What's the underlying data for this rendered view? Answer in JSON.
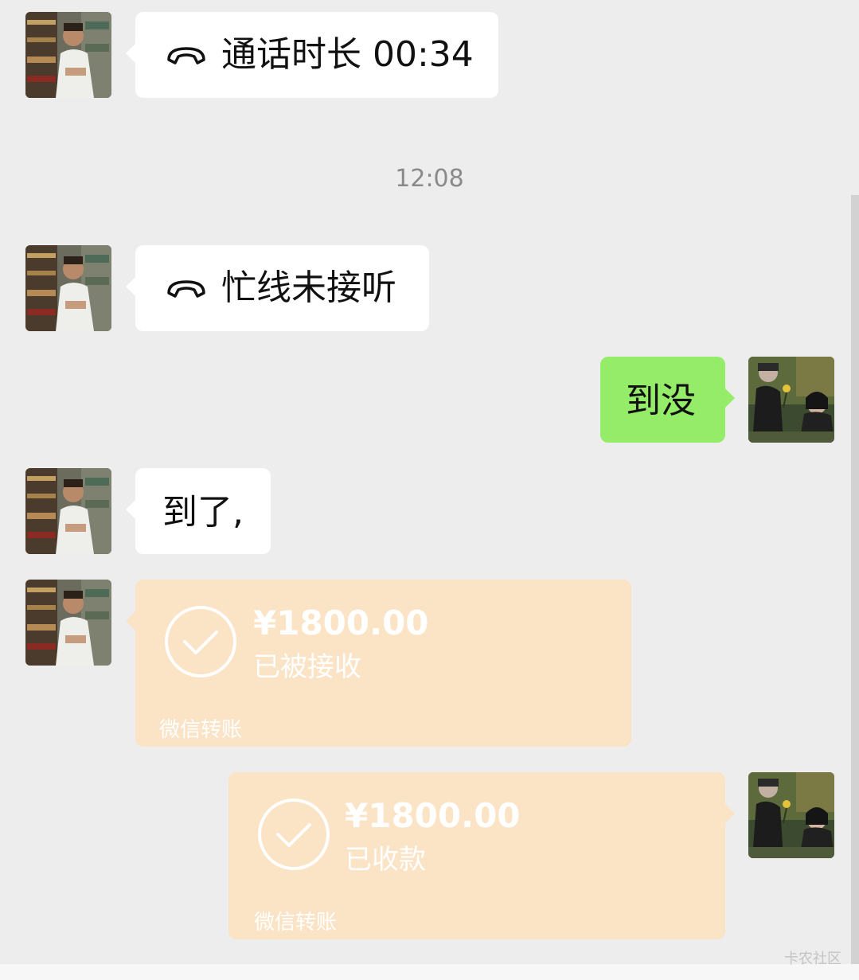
{
  "messages": {
    "call1": {
      "icon": "phone-hangup-icon",
      "text": "通话时长 00:34"
    },
    "timestamp": "12:08",
    "call2": {
      "icon": "phone-hangup-icon",
      "text": "忙线未接听"
    },
    "sent1": {
      "text": "到没"
    },
    "recv1": {
      "text": "到了,"
    },
    "transfer1": {
      "amount": "¥1800.00",
      "status": "已被接收",
      "label": "微信转账",
      "icon": "check-circle-icon"
    },
    "transfer2": {
      "amount": "¥1800.00",
      "status": "已收款",
      "label": "微信转账",
      "icon": "check-circle-icon"
    }
  },
  "watermark": "卡农社区",
  "colors": {
    "background": "#ededed",
    "sent_bubble": "#95ec69",
    "received_bubble": "#ffffff",
    "transfer_bubble": "#fbe3c5",
    "timestamp": "#8a8a8a"
  }
}
